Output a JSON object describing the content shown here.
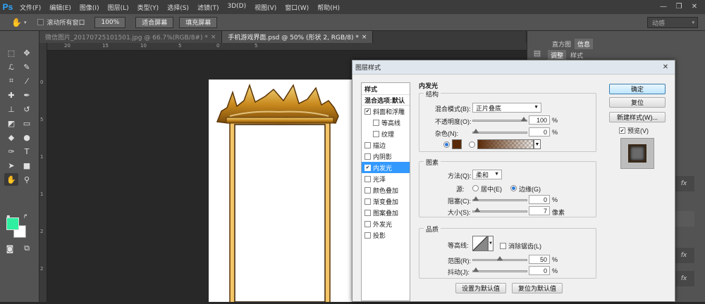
{
  "app": {
    "logo": "Ps",
    "menus": [
      "文件(F)",
      "编辑(E)",
      "图像(I)",
      "图层(L)",
      "类型(Y)",
      "选择(S)",
      "滤镜(T)",
      "3D(D)",
      "视图(V)",
      "窗口(W)",
      "帮助(H)"
    ],
    "window_controls": {
      "minimize": "—",
      "restore": "❐",
      "close": "✕"
    }
  },
  "options": {
    "scroll_all": "滚动所有窗口",
    "zoom100": "100%",
    "fit_screen": "适合屏幕",
    "fill_screen": "填充屏幕",
    "workspace": "动感"
  },
  "tabs": [
    {
      "label": "微信图片_20170725101501.jpg @ 66.7%(RGB/8#) *",
      "close": "×"
    },
    {
      "label": "手机游戏界面.psd @ 50% (形状 2, RGB/8) *",
      "close": "×"
    }
  ],
  "ruler": {
    "h": [
      "20",
      "15",
      "10",
      "5",
      "0",
      "5"
    ],
    "v": [
      "0",
      "5",
      "1",
      "1",
      "2",
      "2",
      "3"
    ]
  },
  "panels": {
    "tab1": "直方图",
    "tab2": "信息",
    "tab3": "调整",
    "tab4": "样式",
    "fx": "fx"
  },
  "dialog": {
    "title": "图层样式",
    "close": "✕",
    "styles_header": "样式",
    "blend_options": "混合选项:默认",
    "style_items": [
      {
        "label": "斜面和浮雕",
        "checked": true,
        "indent": false
      },
      {
        "label": "等高线",
        "checked": false,
        "indent": true
      },
      {
        "label": "纹理",
        "checked": false,
        "indent": true
      },
      {
        "label": "描边",
        "checked": false,
        "indent": false
      },
      {
        "label": "内阴影",
        "checked": false,
        "indent": false
      },
      {
        "label": "内发光",
        "checked": true,
        "indent": false,
        "selected": true
      },
      {
        "label": "光泽",
        "checked": false,
        "indent": false
      },
      {
        "label": "颜色叠加",
        "checked": false,
        "indent": false
      },
      {
        "label": "渐变叠加",
        "checked": false,
        "indent": false
      },
      {
        "label": "图案叠加",
        "checked": false,
        "indent": false
      },
      {
        "label": "外发光",
        "checked": false,
        "indent": false
      },
      {
        "label": "投影",
        "checked": false,
        "indent": false
      }
    ],
    "section_title": "内发光",
    "structure": {
      "title": "结构",
      "blend_mode_label": "混合模式(B):",
      "blend_mode": "正片叠底",
      "opacity_label": "不透明度(O):",
      "opacity": "100",
      "noise_label": "杂色(N):",
      "noise": "0",
      "percent": "%",
      "opacity_level": 1.0,
      "noise_level": 0.0,
      "color": "#5a2a08"
    },
    "elements": {
      "title": "图素",
      "method_label": "方法(Q):",
      "method": "柔和",
      "source_label": "源:",
      "center": "居中(E)",
      "edge": "边缘(G)",
      "choke_label": "阻塞(C):",
      "choke": "0",
      "size_label": "大小(S):",
      "size": "7",
      "unit": "像素",
      "choke_level": 0.0,
      "size_level": 0.03
    },
    "quality": {
      "title": "品质",
      "contour_label": "等高线:",
      "antialias": "消除锯齿(L)",
      "range_label": "范围(R):",
      "range": "50",
      "jitter_label": "抖动(J):",
      "jitter": "0",
      "range_level": 0.5,
      "jitter_level": 0.0
    },
    "set_default": "设置为默认值",
    "reset_default": "复位为默认值",
    "buttons": {
      "ok": "确定",
      "reset": "复位",
      "new_style": "新建样式(W)...",
      "preview": "预览(V)"
    }
  }
}
